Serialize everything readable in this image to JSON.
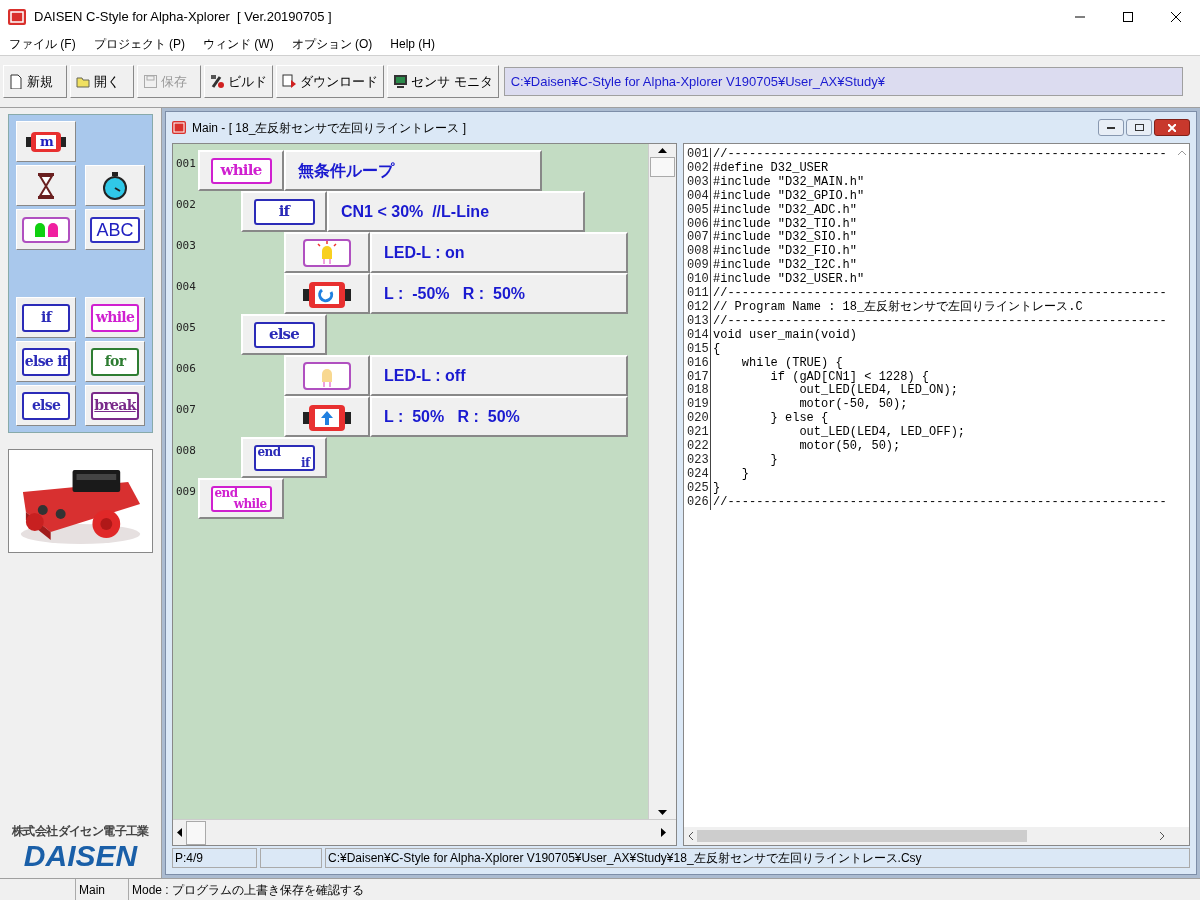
{
  "window": {
    "title": "DAISEN C-Style for Alpha-Xplorer  [ Ver.20190705 ]"
  },
  "menu": [
    "ファイル (F)",
    "プロジェクト (P)",
    "ウィンド (W)",
    "オプション (O)",
    "Help (H)"
  ],
  "toolbar": {
    "buttons": [
      {
        "kind": "new",
        "label": "新規",
        "disabled": false
      },
      {
        "kind": "open",
        "label": "開く",
        "disabled": false
      },
      {
        "kind": "save",
        "label": "保存",
        "disabled": true
      },
      {
        "kind": "build",
        "label": "ビルド",
        "disabled": false
      },
      {
        "kind": "download",
        "label": "ダウンロード",
        "disabled": false
      },
      {
        "kind": "monitor",
        "label": "センサ モニタ",
        "disabled": false
      }
    ],
    "path": "C:¥Daisen¥C-Style for Alpha-Xplorer V190705¥User_AX¥Study¥"
  },
  "palette": {
    "buttons": [
      {
        "kind": "motor",
        "label": "m"
      },
      {
        "kind": "blank"
      },
      {
        "kind": "hourglass"
      },
      {
        "kind": "stopwatch"
      },
      {
        "kind": "leds"
      },
      {
        "kind": "text",
        "label": "ABC"
      },
      {
        "kind": "gap"
      },
      {
        "kind": "gap"
      },
      {
        "kind": "tag",
        "label": "if",
        "color": "#2b2bb8"
      },
      {
        "kind": "tag",
        "label": "while",
        "color": "#d020d0"
      },
      {
        "kind": "tag",
        "label": "else if",
        "color": "#2b2bb8"
      },
      {
        "kind": "tag",
        "label": "for",
        "color": "#2e7d32"
      },
      {
        "kind": "tag",
        "label": "else",
        "color": "#2b2bb8"
      },
      {
        "kind": "break",
        "label": "break",
        "color": "#7a2a8a"
      }
    ]
  },
  "logo": {
    "company": "株式会社ダイセン電子工業",
    "brand": "DAISEN"
  },
  "editor": {
    "title": "Main - [ 18_左反射センサで左回りライントレース ]",
    "blocks": [
      {
        "line": "001",
        "kind": "tag",
        "tag": [
          "while"
        ],
        "color": "#d020d0",
        "text": "無条件ループ",
        "children": [
          {
            "line": "002",
            "kind": "tag",
            "tag": [
              "if"
            ],
            "color": "#2b2bb8",
            "text": "CN1 < 30%  //L-Line",
            "children": [
              {
                "line": "003",
                "kind": "led_on",
                "text": "LED-L : on"
              },
              {
                "line": "004",
                "kind": "motor_turn",
                "text": "L :  -50%   R :  50%"
              }
            ]
          },
          {
            "line": "005",
            "kind": "tag",
            "tag": [
              "else"
            ],
            "color": "#2b2bb8",
            "children": [
              {
                "line": "006",
                "kind": "led_off",
                "text": "LED-L : off"
              },
              {
                "line": "007",
                "kind": "motor_forward",
                "text": "L :  50%   R :  50%"
              }
            ]
          },
          {
            "line": "008",
            "kind": "tag",
            "tag": [
              "end",
              "if"
            ],
            "color": "#2b2bb8"
          }
        ]
      },
      {
        "line": "009",
        "kind": "tag",
        "tag": [
          "end",
          "while"
        ],
        "color": "#d020d0"
      }
    ],
    "code": [
      {
        "n": "001",
        "text": "//-------------------------------------------------------------"
      },
      {
        "n": "002",
        "text": "#define D32_USER"
      },
      {
        "n": "003",
        "text": "#include \"D32_MAIN.h\""
      },
      {
        "n": "004",
        "text": "#include \"D32_GPIO.h\""
      },
      {
        "n": "005",
        "text": "#include \"D32_ADC.h\""
      },
      {
        "n": "006",
        "text": "#include \"D32_TIO.h\""
      },
      {
        "n": "007",
        "text": "#include \"D32_SIO.h\""
      },
      {
        "n": "008",
        "text": "#include \"D32_FIO.h\""
      },
      {
        "n": "009",
        "text": "#include \"D32_I2C.h\""
      },
      {
        "n": "010",
        "text": "#include \"D32_USER.h\""
      },
      {
        "n": "011",
        "text": "//-------------------------------------------------------------"
      },
      {
        "n": "012",
        "text": "// Program Name : 18_左反射センサで左回りライントレース.C"
      },
      {
        "n": "013",
        "text": "//-------------------------------------------------------------"
      },
      {
        "n": "014",
        "text": "void user_main(void)"
      },
      {
        "n": "015",
        "text": "{"
      },
      {
        "n": "016",
        "text": "    while (TRUE) {"
      },
      {
        "n": "017",
        "text": "        if (gAD[CN1] < 1228) {"
      },
      {
        "n": "018",
        "text": "            out_LED(LED4, LED_ON);"
      },
      {
        "n": "019",
        "text": "            motor(-50, 50);"
      },
      {
        "n": "020",
        "text": "        } else {"
      },
      {
        "n": "021",
        "text": "            out_LED(LED4, LED_OFF);"
      },
      {
        "n": "022",
        "text": "            motor(50, 50);"
      },
      {
        "n": "023",
        "text": "        }"
      },
      {
        "n": "024",
        "text": "    }"
      },
      {
        "n": "025",
        "text": "}"
      },
      {
        "n": "026",
        "text": "//-------------------------------------------------------------"
      }
    ],
    "status": [
      "P:4/9",
      "C:¥Daisen¥C-Style for Alpha-Xplorer V190705¥User_AX¥Study¥18_左反射センサで左回りライントレース.Csy"
    ]
  },
  "status_bar": [
    "Main",
    "Mode : プログラムの上書き保存を確認する"
  ]
}
